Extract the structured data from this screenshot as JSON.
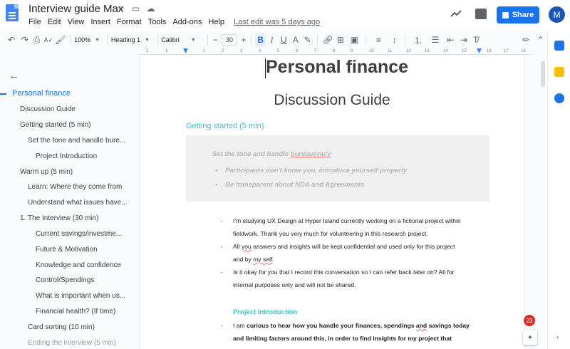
{
  "app": {
    "doc_title": "Interview guide Max",
    "menus": [
      "File",
      "Edit",
      "View",
      "Insert",
      "Format",
      "Tools",
      "Add-ons",
      "Help"
    ],
    "last_edit": "Last edit was 5 days ago",
    "share_label": "Share",
    "avatar_initial": "M",
    "accent": "#1a73e8"
  },
  "toolbar": {
    "zoom": "100%",
    "style": "Heading 1",
    "font": "Calibri",
    "font_size": "30",
    "minus": "−",
    "plus": "+",
    "bold": "B",
    "italic": "I",
    "underline": "U",
    "text_color": "A"
  },
  "ruler": {
    "ticks": [
      "2",
      "1",
      "1",
      "2",
      "3",
      "4",
      "5",
      "6",
      "7",
      "8",
      "9",
      "10",
      "11",
      "12",
      "13",
      "14",
      "15",
      "16",
      "17",
      "18"
    ]
  },
  "outline": {
    "items": [
      {
        "label": "Personal finance",
        "level": 0,
        "active": true
      },
      {
        "label": "Discussion Guide",
        "level": 1
      },
      {
        "label": "Getting started (5 min)",
        "level": 1
      },
      {
        "label": "Set the tone and handle bure...",
        "level": 2
      },
      {
        "label": "Project Introduction",
        "level": 3
      },
      {
        "label": "Warm up (5 min)",
        "level": 1
      },
      {
        "label": "Learn: Where they come from",
        "level": 2
      },
      {
        "label": "Understand what issues have...",
        "level": 2
      },
      {
        "label": "1. The Interview (30 min)",
        "level": 1
      },
      {
        "label": "Current savings/investme...",
        "level": 3
      },
      {
        "label": "Future & Motivation",
        "level": 3
      },
      {
        "label": "Knowledge and confidence",
        "level": 3
      },
      {
        "label": "Control/Spendings",
        "level": 3
      },
      {
        "label": "What is important when us...",
        "level": 3
      },
      {
        "label": "Financial health? (If time)",
        "level": 3
      },
      {
        "label": "Card sorting (10 min)",
        "level": 2
      },
      {
        "label": "Ending the interview (5 min)",
        "level": 2
      }
    ]
  },
  "doc": {
    "title": "Personal finance",
    "subtitle": "Discussion Guide",
    "section1": "Getting started (5 min)",
    "box_title_pre": "Set the tone and handle ",
    "box_title_ul": "bureaucracy",
    "box_bullets": [
      "Participants don't know you, introduce yourself properly",
      "Be transparent about NDA and Agreements"
    ],
    "dash": "-",
    "p1_l1": "I'm studying UX Design at Hyper Island currently working on a fictional project within",
    "p1_l2": "fieldwork.  Thank you very much for volunteering in this research project.",
    "p2_l1_pre": "All ",
    "p2_l1_ul": "you",
    "p2_l1_post": " answers and insights will be kept confidential and used only for this project",
    "p2_l2_pre": "and by ",
    "p2_l2_ul": "my self",
    "p2_l2_post": ".",
    "p3_l1": "Is it okay for you that I record this conversation so I can refer back later on? All for",
    "p3_l2": "internal purposes only and will not be shared.",
    "project_heading": "Project Introduction",
    "p4_l1_pre": "I am ",
    "p4_l1_bold_a": "curious to hear how you handle your finances, spendings ",
    "p4_l1_ul": "and",
    "p4_l1_bold_b": " savings today",
    "p4_l2": "and limiting factors around this, in order to find insights for my project that"
  },
  "notifications": {
    "count": "23"
  }
}
